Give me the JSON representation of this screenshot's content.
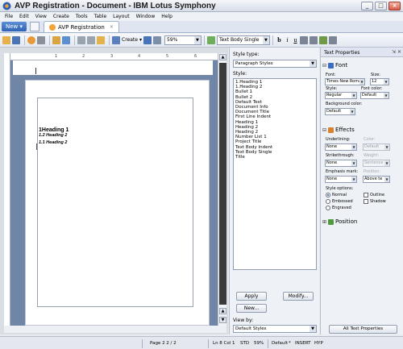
{
  "window": {
    "title": "AVP Registration - Document - IBM Lotus Symphony",
    "controls": {
      "minimize": "_",
      "maximize": "□",
      "close": "×"
    }
  },
  "menubar": {
    "items": [
      "File",
      "Edit",
      "View",
      "Create",
      "Tools",
      "Table",
      "Layout",
      "Window",
      "Help"
    ]
  },
  "tabbar": {
    "new_label": "New",
    "document_tab": {
      "label": "AVP Registration",
      "close": "×"
    }
  },
  "toolbar": {
    "create_label": "Create",
    "zoom": "59%",
    "paragraph_style": "Text Body Single",
    "bold": "b",
    "italic": "i",
    "underline": "u"
  },
  "document": {
    "ruler_numbers": [
      "1",
      "2",
      "3",
      "4",
      "5",
      "6"
    ],
    "lines": [
      {
        "text": "1Heading 1",
        "style": "heading1"
      },
      {
        "text": "1.1 Heading 2",
        "style": "heading2"
      },
      {
        "text": "1.2 Heading 2",
        "style": "heading2"
      }
    ]
  },
  "styles_panel": {
    "style_type_label": "Style type:",
    "style_type_value": "Paragraph Styles",
    "style_label": "Style:",
    "styles": [
      "1.Heading 1",
      "1.Heading 2",
      "Bullet 1",
      "Bullet 2",
      "Default Text",
      "Document Info",
      "Document Title",
      "First Line Indent",
      "Heading 1",
      "Heading 2",
      "Heading 2",
      "Number List 1",
      "Project Title",
      "Text Body Indent",
      "Text Body Single",
      "Title"
    ],
    "apply_button": "Apply",
    "modify_button": "Modify...",
    "new_button": "New...",
    "view_by_label": "View by:",
    "view_by_value": "Default Styles"
  },
  "props_panel": {
    "title": "Text Properties",
    "header_icons": "⇲ ✕",
    "font_section": "Font",
    "font_label": "Font:",
    "font_value": "Times New Roman",
    "size_label": "Size:",
    "size_value": "12",
    "style_label": "Style:",
    "style_value": "Regular",
    "font_color_label": "Font color:",
    "font_color_value": "Default",
    "bg_color_label": "Background color:",
    "bg_color_value": "Default",
    "effects_section": "Effects",
    "underlining_label": "Underlining:",
    "underlining_value": "None",
    "color_label": "Color:",
    "color_value": "Default",
    "strikethrough_label": "Strikethrough:",
    "strikethrough_value": "None",
    "weight_label": "Weight:",
    "weight_value": "Sentence",
    "emphasis_label": "Emphasis mark:",
    "emphasis_value": "None",
    "position_label": "Position:",
    "position_value": "Above te",
    "style_options_label": "Style options:",
    "options": {
      "normal": "Normal",
      "embossed": "Embossed",
      "engraved": "Engraved",
      "outline": "Outline",
      "shadow": "Shadow"
    },
    "position_section": "Position",
    "all_props_button": "All Text Properties"
  },
  "statusbar": {
    "page": "Page 2  2 / 2",
    "cursor": "Ln 8  Col 1",
    "std": "STD",
    "zoom": "59%",
    "default": "Default",
    "star": "*",
    "insert": "INSERT",
    "hyp": "HYP"
  },
  "colors": {
    "accent": "#2f62b4",
    "canvas": "#6f86a6",
    "scroll_thumb": "#3a3a3a"
  }
}
